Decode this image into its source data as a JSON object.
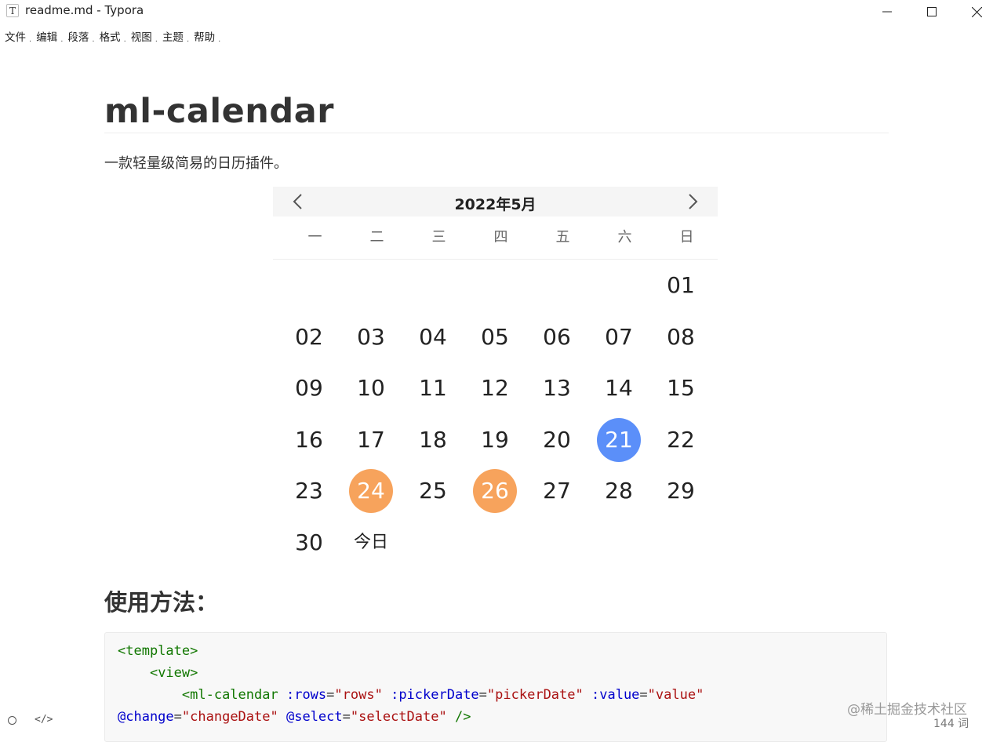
{
  "window": {
    "app_icon_letter": "T",
    "title": "readme.md - Typora"
  },
  "menu": [
    {
      "label": "文件"
    },
    {
      "label": "编辑"
    },
    {
      "label": "段落"
    },
    {
      "label": "格式"
    },
    {
      "label": "视图"
    },
    {
      "label": "主题"
    },
    {
      "label": "帮助"
    }
  ],
  "doc": {
    "title": "ml-calendar",
    "intro": "一款轻量级简易的日历插件。",
    "usage_heading": "使用方法："
  },
  "calendar": {
    "month_title": "2022年5月",
    "weekdays": [
      "一",
      "二",
      "三",
      "四",
      "五",
      "六",
      "日"
    ],
    "rows": [
      [
        "",
        "",
        "",
        "",
        "",
        "",
        "01"
      ],
      [
        "02",
        "03",
        "04",
        "05",
        "06",
        "07",
        "08"
      ],
      [
        "09",
        "10",
        "11",
        "12",
        "13",
        "14",
        "15"
      ],
      [
        "16",
        "17",
        "18",
        "19",
        "20",
        "21",
        "22"
      ],
      [
        "23",
        "24",
        "25",
        "26",
        "27",
        "28",
        "29"
      ],
      [
        "30",
        "今日",
        "",
        "",
        "",
        "",
        ""
      ]
    ],
    "selected_day": "21",
    "marked_days": [
      "24",
      "26"
    ],
    "colors": {
      "selected": "#5b8ff9",
      "marked": "#f7a35c"
    }
  },
  "code": {
    "lines": [
      [
        {
          "t": "tag",
          "v": "<template>"
        }
      ],
      [
        {
          "t": "plain",
          "v": "    "
        },
        {
          "t": "tag",
          "v": "<view>"
        }
      ],
      [
        {
          "t": "plain",
          "v": "        "
        },
        {
          "t": "tag",
          "v": "<ml-calendar"
        },
        {
          "t": "plain",
          "v": " "
        },
        {
          "t": "attr",
          "v": ":rows"
        },
        {
          "t": "plain",
          "v": "="
        },
        {
          "t": "str",
          "v": "\"rows\""
        },
        {
          "t": "plain",
          "v": " "
        },
        {
          "t": "attr",
          "v": ":pickerDate"
        },
        {
          "t": "plain",
          "v": "="
        },
        {
          "t": "str",
          "v": "\"pickerDate\""
        },
        {
          "t": "plain",
          "v": " "
        },
        {
          "t": "attr",
          "v": ":value"
        },
        {
          "t": "plain",
          "v": "="
        },
        {
          "t": "str",
          "v": "\"value\""
        }
      ],
      [
        {
          "t": "attr",
          "v": "@change"
        },
        {
          "t": "plain",
          "v": "="
        },
        {
          "t": "str",
          "v": "\"changeDate\""
        },
        {
          "t": "plain",
          "v": " "
        },
        {
          "t": "attr",
          "v": "@select"
        },
        {
          "t": "plain",
          "v": "="
        },
        {
          "t": "str",
          "v": "\"selectDate\""
        },
        {
          "t": "plain",
          "v": " "
        },
        {
          "t": "tag",
          "v": "/>"
        }
      ]
    ]
  },
  "footer": {
    "source_toggle": "</>",
    "watermark": "@稀土掘金技术社区",
    "word_count": "144 词"
  }
}
